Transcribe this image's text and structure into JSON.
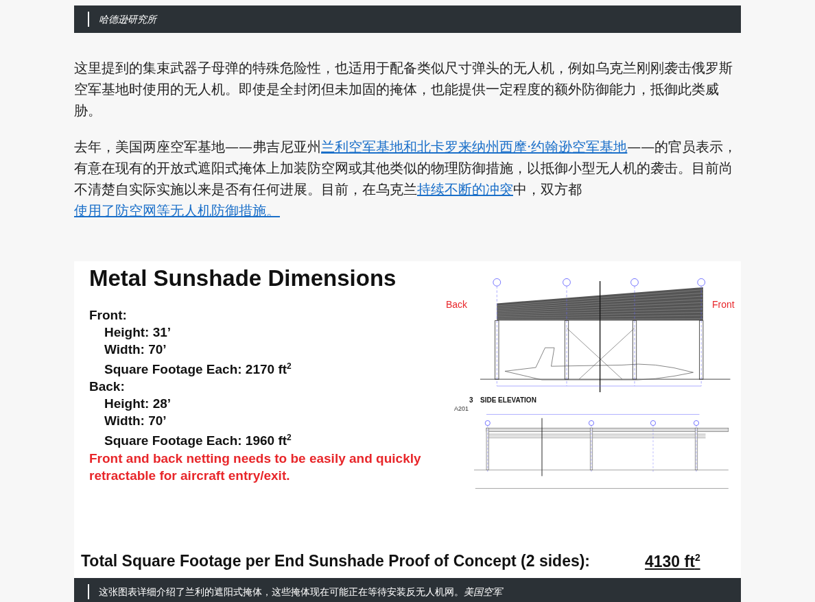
{
  "top_caption": {
    "text": "哈德逊研究所"
  },
  "paragraphs": [
    [
      {
        "text": "这里提到的集束武器子母弹的特殊危险性，也适用于配备类似尺寸弹头的无人机，例如乌克兰刚刚袭击俄罗斯空军基地时使用的无人机。即使是全封闭但未加固的掩体，也能提供一定程度的额外防御能力，抵御此类威胁。",
        "link": false
      }
    ],
    [
      {
        "text": "去年，美国两座空军基地——弗吉尼亚州",
        "link": false
      },
      {
        "text": "兰利空军基地和北卡罗来纳州西摩·约翰逊空军基地",
        "link": true
      },
      {
        "text": "——的官员表示，有意在现有的开放式遮阳式掩体上加装防空网或其他类似的物理防御措施，以抵御小型无人机的袭击。目前尚不清楚自实际实施以来是否有任何进展。目前，在乌克兰",
        "link": false
      },
      {
        "text": "持续不断的冲突",
        "link": true
      },
      {
        "text": "中，双方都",
        "link": false
      },
      {
        "text": "使用了防空网等无人机防御措施。",
        "link": true
      }
    ]
  ],
  "slide": {
    "title": "Metal Sunshade Dimensions",
    "lines": [
      {
        "kind": "heading",
        "text": "Front:"
      },
      {
        "kind": "item",
        "text": "Height:  31’"
      },
      {
        "kind": "item",
        "text": "Width:  70’"
      },
      {
        "kind": "item",
        "text": "Square Footage Each:  2170 ft$^{2}$"
      },
      {
        "kind": "heading",
        "text": "Back:"
      },
      {
        "kind": "item",
        "text": "Height:  28’"
      },
      {
        "kind": "item",
        "text": "Width:  70’"
      },
      {
        "kind": "item",
        "text": "Square Footage Each: 1960 ft$^{2}$"
      },
      {
        "kind": "warning",
        "text": "Front and back netting needs to be easily and quickly retractable for aircraft entry/exit."
      }
    ],
    "back_label": "Back",
    "front_label": "Front",
    "elevation_number": "3",
    "elevation_title": "SIDE ELEVATION",
    "sheet": "A201",
    "total_label": "Total Square Footage per End Sunshade Proof of Concept (2 sides):",
    "total_value": "4130 ft$^{2}$"
  },
  "bottom_caption": {
    "text": "这张图表详细介绍了兰利的遮阳式掩体，这些掩体现在可能正在等待安装反无人机网。",
    "credit": "美国空军"
  }
}
